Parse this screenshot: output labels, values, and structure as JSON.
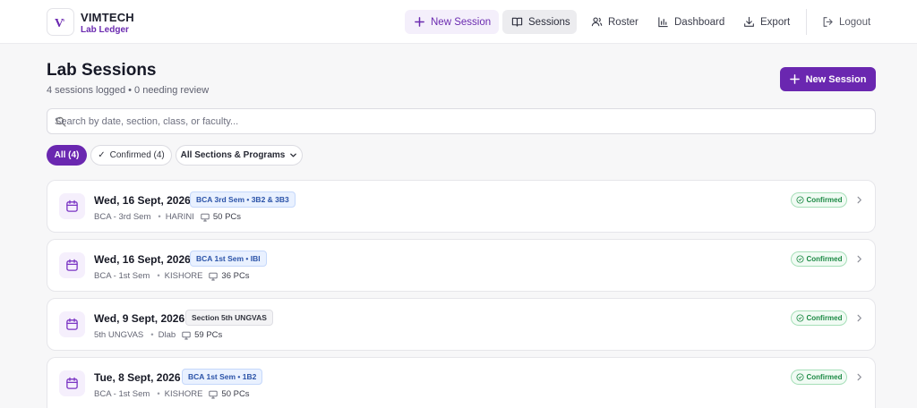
{
  "brand": {
    "name": "VIMTECH",
    "subtitle": "Lab Ledger",
    "logo_mark": "V"
  },
  "nav": {
    "new_session": "New Session",
    "sessions": "Sessions",
    "roster": "Roster",
    "dashboard": "Dashboard",
    "export": "Export",
    "logout": "Logout"
  },
  "page": {
    "title": "Lab Sessions",
    "subtitle": "4 sessions logged • 0 needing review",
    "new_session_button": "New Session"
  },
  "search": {
    "placeholder": "Search by date, section, class, or faculty...",
    "value": ""
  },
  "filters": {
    "all": "All (4)",
    "confirmed": "Confirmed (4)",
    "confirmed_check": "✓",
    "section_select": "All Sections & Programs"
  },
  "sessions": [
    {
      "date": "Wed, 16 Sept, 2026",
      "tag": "BCA 3rd Sem • 3B2 & 3B3",
      "tag_style": "blue",
      "program": "BCA - 3rd Sem",
      "faculty": "HARINI",
      "pcs": "50 PCs",
      "status": "Confirmed"
    },
    {
      "date": "Wed, 16 Sept, 2026",
      "tag": "BCA 1st Sem • IBI",
      "tag_style": "blue",
      "program": "BCA - 1st Sem",
      "faculty": "KISHORE",
      "pcs": "36 PCs",
      "status": "Confirmed"
    },
    {
      "date": "Wed, 9 Sept, 2026",
      "tag": "Section 5th UNGVAS",
      "tag_style": "gray",
      "program": "5th UNGVAS",
      "faculty": "Dlab",
      "pcs": "59 PCs",
      "status": "Confirmed"
    },
    {
      "date": "Tue, 8 Sept, 2026",
      "tag": "BCA 1st Sem • 1B2",
      "tag_style": "blue",
      "program": "BCA - 1st Sem",
      "faculty": "KISHORE",
      "pcs": "50 PCs",
      "status": "Confirmed"
    }
  ],
  "colors": {
    "brand": "#6a27b0",
    "tag_blue": "#2b53a8",
    "status_green": "#1d8a45"
  },
  "icons": {
    "new": "plus-icon",
    "sessions": "book-icon",
    "roster": "users-icon",
    "dashboard": "bar-chart-icon",
    "export": "download-icon",
    "logout": "logout-icon",
    "search": "search-icon",
    "session": "calendar-icon",
    "pcs": "monitor-icon",
    "status": "check-circle-icon",
    "open": "chevron-right-icon"
  }
}
